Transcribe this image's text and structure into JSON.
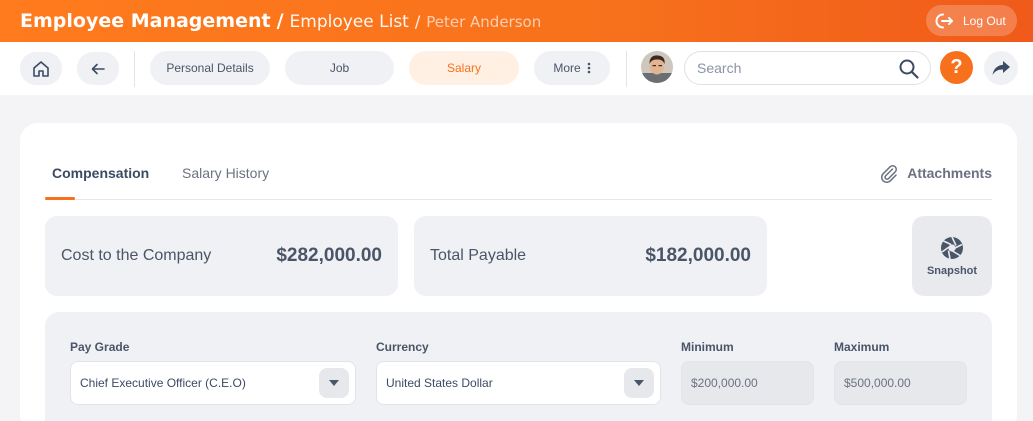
{
  "header": {
    "breadcrumb_root": "Employee Management",
    "breadcrumb_section": "Employee List",
    "breadcrumb_current": "Peter Anderson",
    "logout_label": "Log Out"
  },
  "toolbar": {
    "tabs": [
      {
        "label": "Personal Details"
      },
      {
        "label": "Job"
      },
      {
        "label": "Salary"
      },
      {
        "label": "More"
      }
    ],
    "search_placeholder": "Search",
    "help_label": "?"
  },
  "content": {
    "tabs": [
      {
        "label": "Compensation"
      },
      {
        "label": "Salary History"
      }
    ],
    "attachments_label": "Attachments",
    "cost_to_company": {
      "label": "Cost to the Company",
      "value": "$282,000.00"
    },
    "total_payable": {
      "label": "Total Payable",
      "value": "$182,000.00"
    },
    "snapshot_label": "Snapshot",
    "form": {
      "pay_grade": {
        "label": "Pay Grade",
        "value": "Chief Executive Officer (C.E.O)"
      },
      "currency": {
        "label": "Currency",
        "value": "United States Dollar"
      },
      "minimum": {
        "label": "Minimum",
        "value": "$200,000.00"
      },
      "maximum": {
        "label": "Maximum",
        "value": "$500,000.00"
      }
    }
  },
  "colors": {
    "accent": "#f7711c",
    "active_tab_bg": "#fff0e3"
  },
  "icons": [
    "home-icon",
    "back-arrow-icon",
    "more-dots-icon",
    "search-icon",
    "help-icon",
    "share-icon",
    "logout-icon",
    "paperclip-icon",
    "camera-shutter-icon",
    "chevron-down-icon"
  ]
}
